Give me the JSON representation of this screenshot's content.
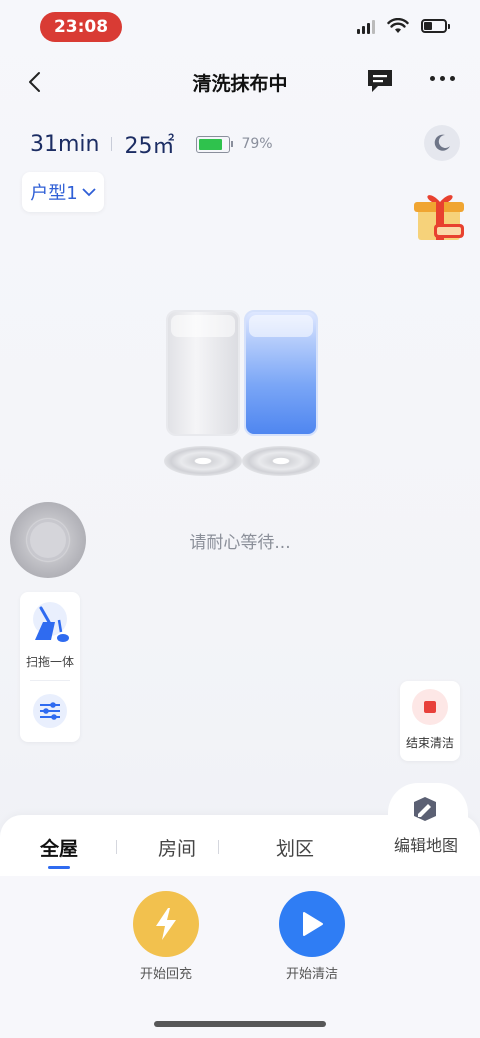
{
  "status_bar": {
    "time": "23:08"
  },
  "header": {
    "title": "清洗抹布中"
  },
  "info": {
    "duration": "31min",
    "area": "25㎡",
    "battery_percent": "79%",
    "battery_level": 0.79,
    "battery_color": "#2fc24d"
  },
  "layout_selector": {
    "label": "户型1"
  },
  "main": {
    "wait_text": "请耐心等待..."
  },
  "mode_panel": {
    "mode_label": "扫拖一体"
  },
  "stop": {
    "label": "结束清洁"
  },
  "tabs": [
    {
      "label": "全屋",
      "active": true
    },
    {
      "label": "房间",
      "active": false
    },
    {
      "label": "划区",
      "active": false
    }
  ],
  "edit_map": {
    "label": "编辑地图"
  },
  "actions": {
    "charge_label": "开始回充",
    "start_label": "开始清洁"
  },
  "colors": {
    "accent": "#2f7df4",
    "charge": "#f2c14e",
    "stop": "#e8413b"
  }
}
